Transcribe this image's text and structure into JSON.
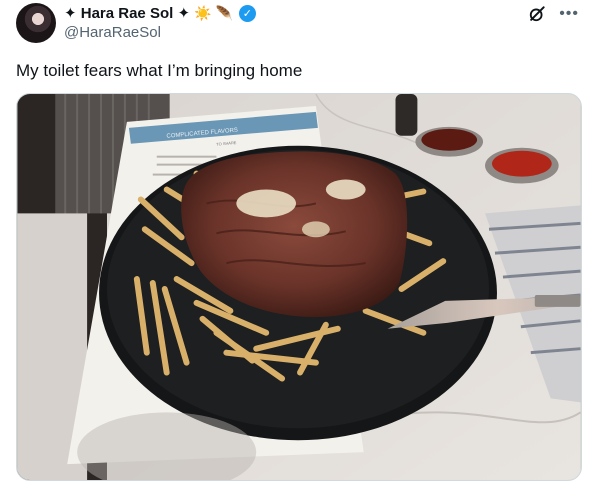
{
  "post": {
    "author_name": "✦ Hara Rae Sol ✦",
    "name_emojis": [
      "☀️",
      "🪶"
    ],
    "handle": "@HaraRaeSol",
    "text": "My toilet fears what I’m bringing home"
  },
  "media": {
    "menu_heading": "COMPLICATED FLAVORS",
    "menu_subheading": "TO SHARE"
  },
  "icons": {
    "grok": "grok-icon",
    "more": "more-icon",
    "verified": "verified-badge-icon"
  },
  "colors": {
    "accent": "#1d9bf0",
    "text": "#0f1419",
    "secondary": "#536471"
  }
}
